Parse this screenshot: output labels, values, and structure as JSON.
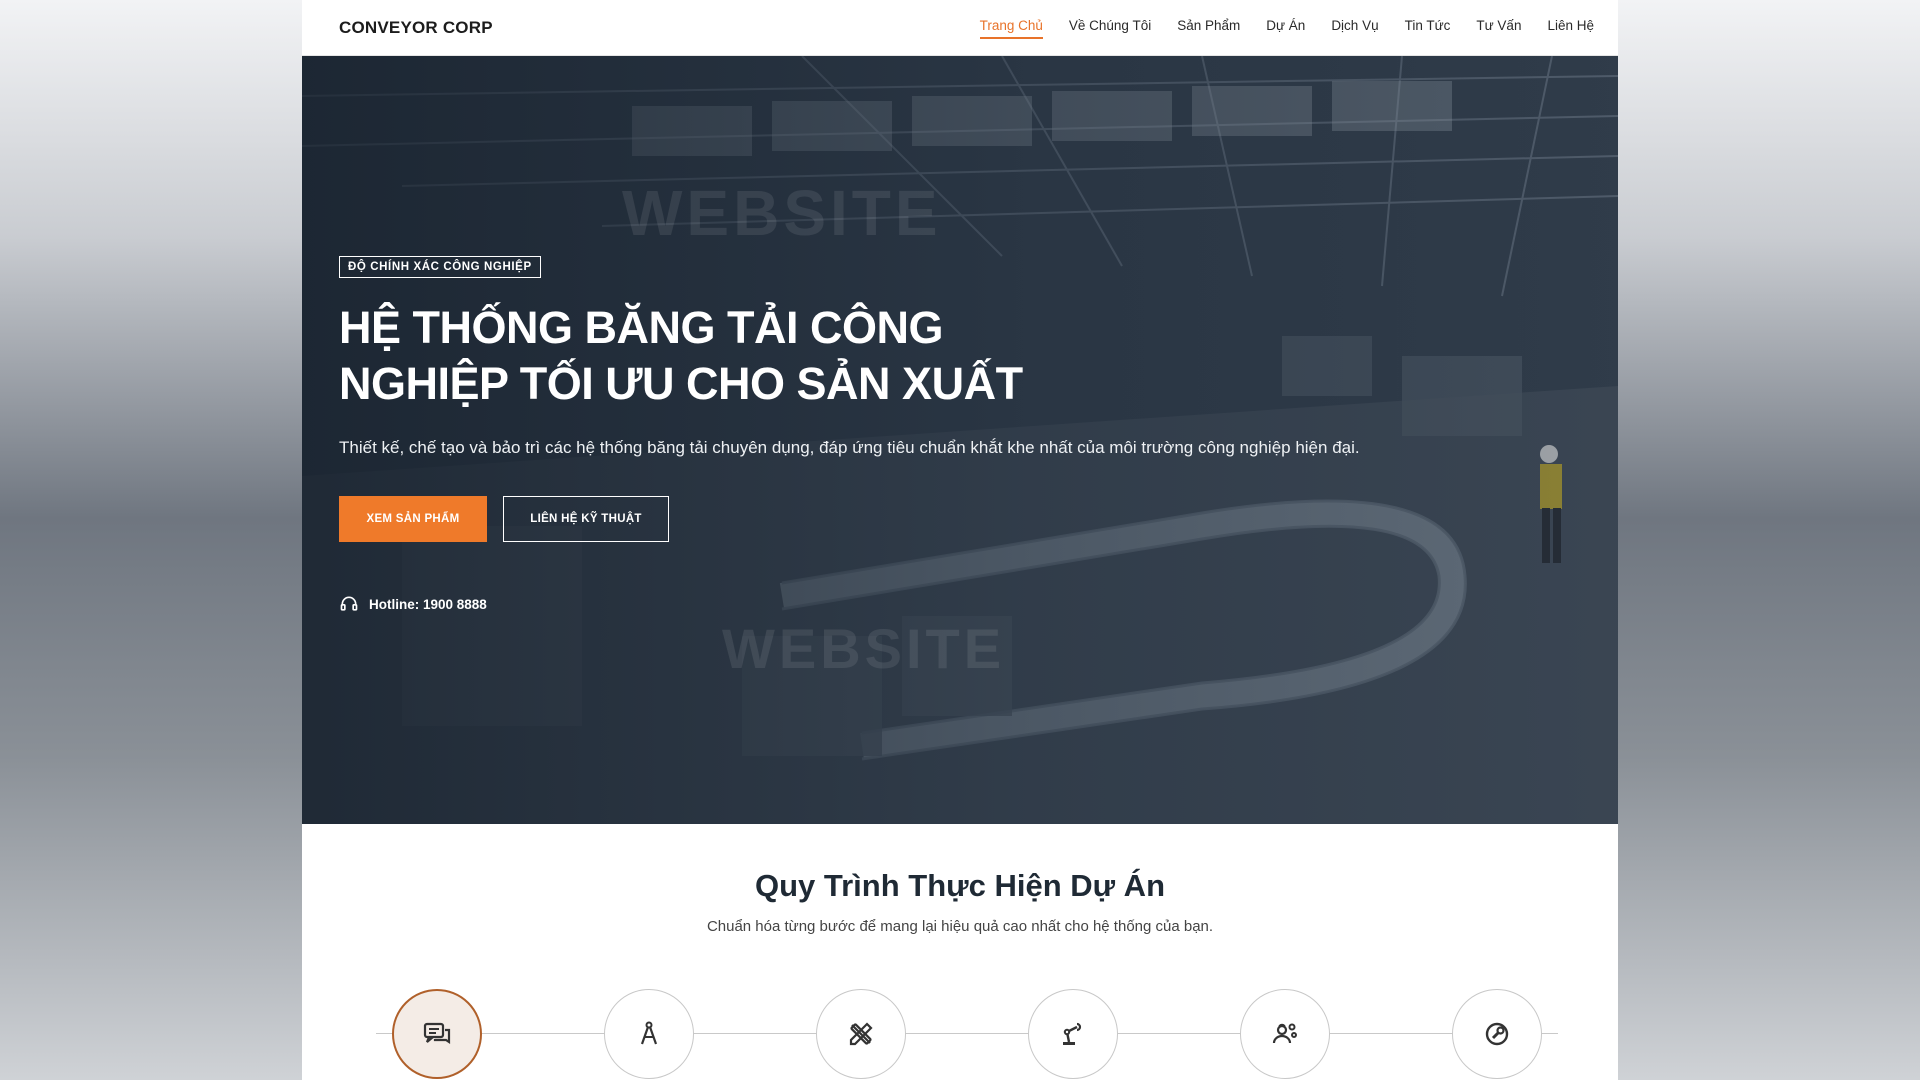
{
  "brand": {
    "logo": "CONVEYOR CORP",
    "accent": "#ef7a2a"
  },
  "nav": [
    {
      "label": "Trang Chủ",
      "active": true
    },
    {
      "label": "Về Chúng Tôi"
    },
    {
      "label": "Sản Phẩm"
    },
    {
      "label": "Dự Án"
    },
    {
      "label": "Dịch Vụ"
    },
    {
      "label": "Tin Tức"
    },
    {
      "label": "Tư Vấn"
    },
    {
      "label": "Liên Hệ"
    }
  ],
  "hero": {
    "tag": "ĐỘ CHÍNH XÁC CÔNG NGHIỆP",
    "title": "HỆ THỐNG BĂNG TẢI CÔNG NGHIỆP TỐI ƯU CHO SẢN XUẤT",
    "subtitle": "Thiết kế, chế tạo và bảo trì các hệ thống băng tải chuyên dụng, đáp ứng tiêu chuẩn khắt khe nhất của môi trường công nghiệp hiện đại.",
    "primary_button": "XEM SẢN PHẨM",
    "secondary_button": "LIÊN HỆ KỸ THUẬT",
    "hotline": "Hotline: 1900 8888"
  },
  "process": {
    "title": "Quy Trình Thực Hiện Dự Án",
    "subtitle": "Chuẩn hóa từng bước để mang lại hiệu quả cao nhất cho hệ thống của bạn.",
    "steps": [
      {
        "icon": "consultation-icon",
        "active": true
      },
      {
        "icon": "drafting-compass-icon"
      },
      {
        "icon": "design-tools-icon"
      },
      {
        "icon": "robotic-arm-icon"
      },
      {
        "icon": "installation-team-icon"
      },
      {
        "icon": "maintenance-wrench-icon"
      }
    ]
  }
}
